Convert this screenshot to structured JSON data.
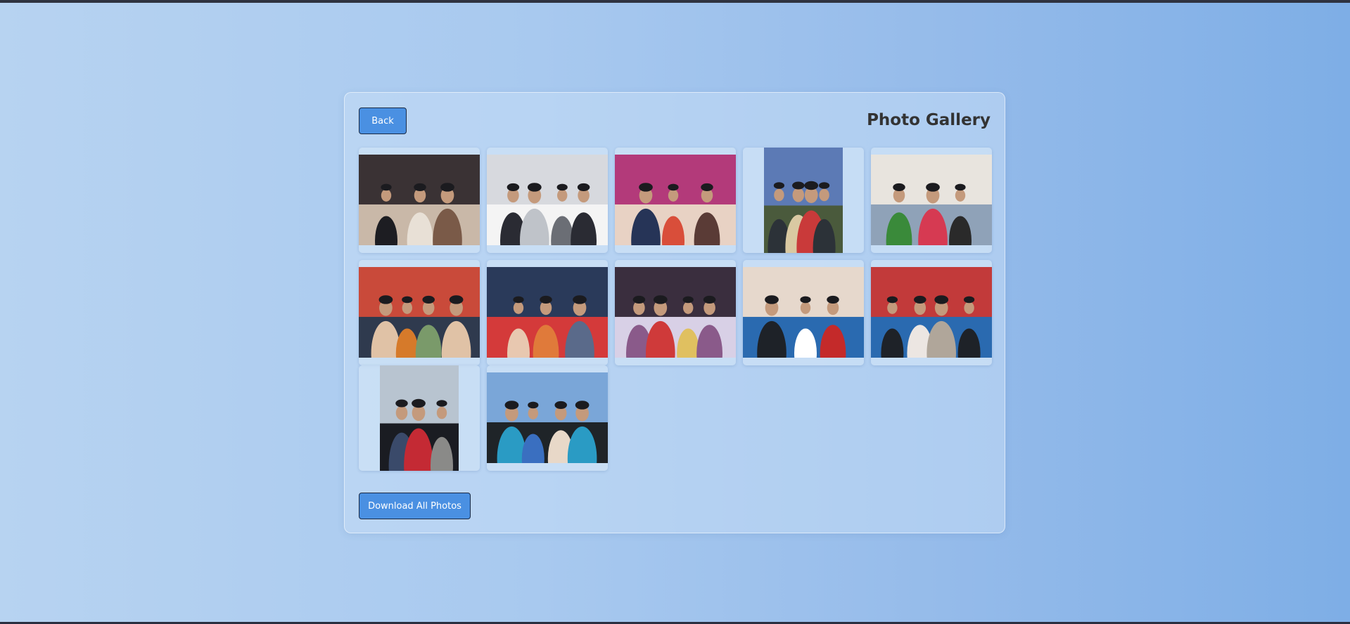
{
  "header": {
    "back_label": "Back",
    "title": "Photo Gallery"
  },
  "footer": {
    "download_label": "Download All Photos"
  },
  "gallery": {
    "photos": [
      {
        "orientation": "landscape",
        "palette": [
          "#3a3234",
          "#c9b8a8",
          "#1d1d22",
          "#e8e0d6",
          "#7a5a48"
        ]
      },
      {
        "orientation": "landscape",
        "palette": [
          "#d7d9de",
          "#f4f4f4",
          "#2a2b33",
          "#bfc3c9",
          "#6b6e75"
        ]
      },
      {
        "orientation": "landscape",
        "palette": [
          "#b33a7a",
          "#e8d2c4",
          "#263457",
          "#d94e3a",
          "#5a3b36"
        ]
      },
      {
        "orientation": "portrait",
        "palette": [
          "#5c7ab5",
          "#4a5a3c",
          "#2c3238",
          "#d9c9a2",
          "#c93a3a"
        ]
      },
      {
        "orientation": "landscape",
        "palette": [
          "#e8e4de",
          "#8fa2b8",
          "#3a8a3a",
          "#d63a52",
          "#2a2a2a"
        ]
      },
      {
        "orientation": "landscape",
        "palette": [
          "#c94a3a",
          "#2f3a4e",
          "#e0c2a6",
          "#d67a2a",
          "#7a9a6a"
        ]
      },
      {
        "orientation": "landscape",
        "palette": [
          "#2a3a5a",
          "#d43a3a",
          "#e8c8b0",
          "#e07a3a",
          "#5a6a8a"
        ]
      },
      {
        "orientation": "landscape",
        "palette": [
          "#3a2e3e",
          "#d8d0e6",
          "#8a5a8a",
          "#cf3a3a",
          "#e0c060"
        ]
      },
      {
        "orientation": "landscape",
        "palette": [
          "#e6d8cc",
          "#2a6ab0",
          "#1e2228",
          "#ffffff",
          "#c42a2a"
        ]
      },
      {
        "orientation": "landscape",
        "palette": [
          "#c23a3a",
          "#2a6ab0",
          "#1e2228",
          "#ece6e2",
          "#b0a69a"
        ]
      },
      {
        "orientation": "portrait",
        "palette": [
          "#b8c4d0",
          "#1a1c22",
          "#3a4a6a",
          "#c42a34",
          "#8a8a88"
        ]
      },
      {
        "orientation": "landscape",
        "palette": [
          "#7aa6d8",
          "#1f2428",
          "#2a9bc4",
          "#3a6fc0",
          "#e8d8c8"
        ]
      }
    ]
  }
}
